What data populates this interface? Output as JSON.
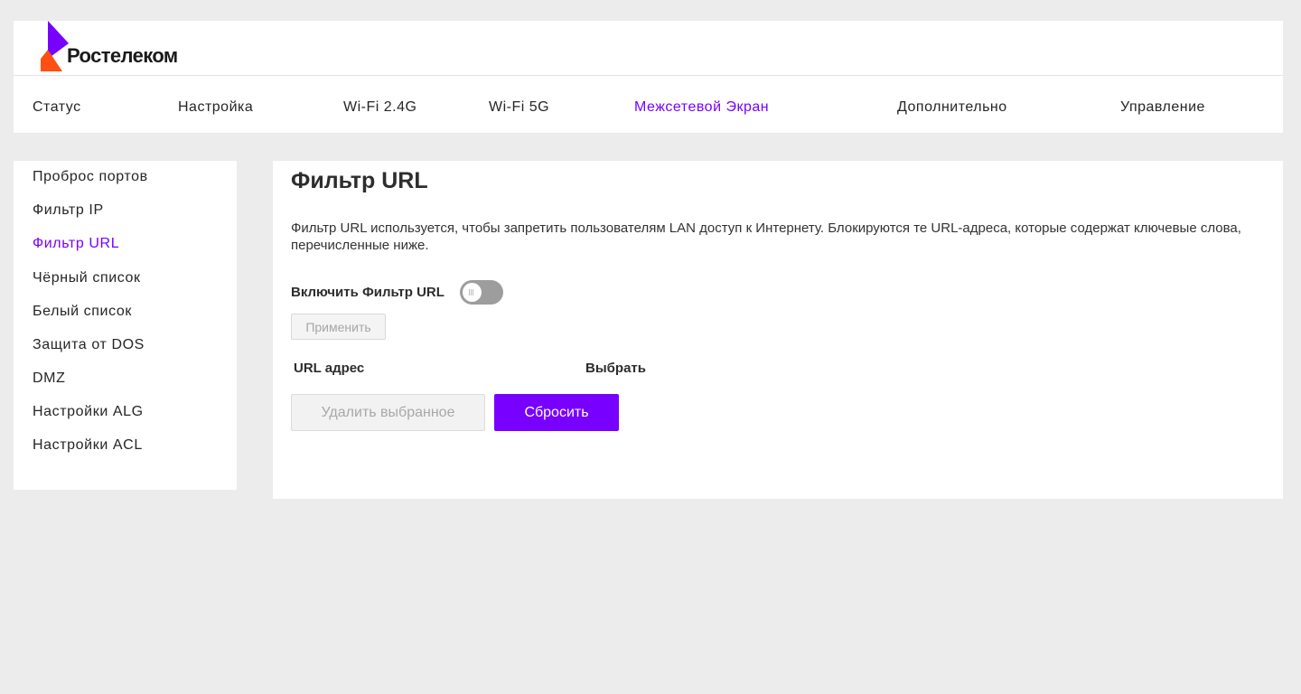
{
  "brand": {
    "name": "Ростелеком",
    "colors": {
      "purple": "#7700ff",
      "orange": "#ff4f12"
    }
  },
  "nav": {
    "items": [
      {
        "label": "Статус"
      },
      {
        "label": "Настройка"
      },
      {
        "label": "Wi-Fi 2.4G"
      },
      {
        "label": "Wi-Fi 5G"
      },
      {
        "label": "Межсетевой Экран"
      },
      {
        "label": "Дополнительно"
      },
      {
        "label": "Управление"
      }
    ],
    "active_label": "Межсетевой Экран"
  },
  "sidebar": {
    "items": [
      {
        "label": "Проброс портов"
      },
      {
        "label": "Фильтр IP"
      },
      {
        "label": "Фильтр URL"
      },
      {
        "label": "Чёрный список"
      },
      {
        "label": "Белый список"
      },
      {
        "label": "Защита от DOS"
      },
      {
        "label": "DMZ"
      },
      {
        "label": "Настройки ALG"
      },
      {
        "label": "Настройки ACL"
      }
    ],
    "active_label": "Фильтр URL"
  },
  "content": {
    "title": "Фильтр URL",
    "description": "Фильтр URL используется, чтобы запретить пользователям LAN доступ к Интернету. Блокируются те URL-адреса, которые содержат ключевые слова, перечисленные ниже.",
    "toggle_label": "Включить Фильтр URL",
    "toggle_enabled": false,
    "apply_label": "Применить",
    "table": {
      "columns": [
        "URL адрес",
        "Выбрать"
      ],
      "rows": []
    },
    "delete_label": "Удалить выбранное",
    "reset_label": "Сбросить"
  }
}
